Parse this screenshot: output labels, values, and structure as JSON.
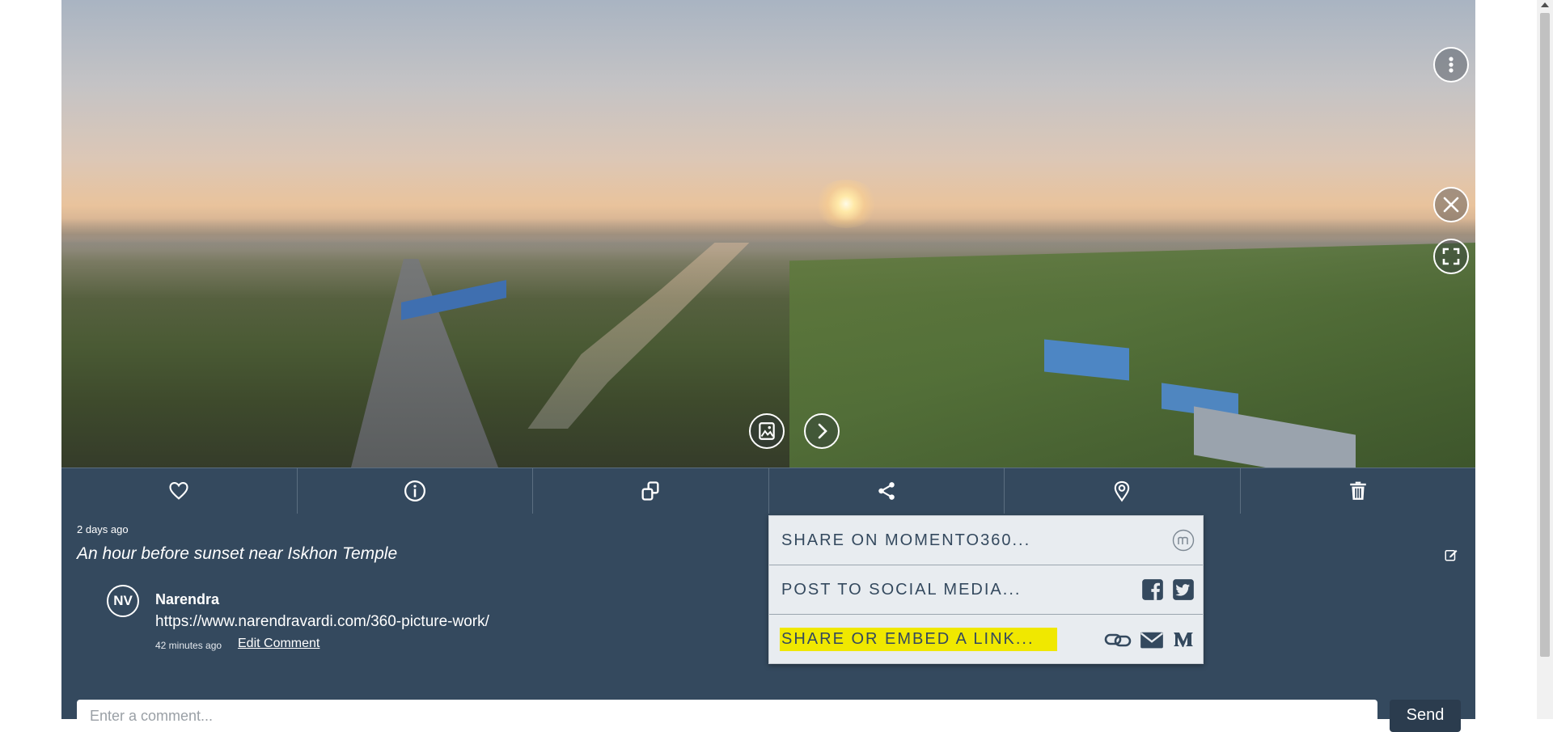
{
  "viewer": {
    "icons": {
      "menu": "more-vertical-icon",
      "close": "close-icon",
      "fullscreen": "fullscreen-icon",
      "image_info": "image-info-icon",
      "next": "chevron-right-icon"
    }
  },
  "toolbar": {
    "items": [
      {
        "name": "like",
        "icon": "heart-icon"
      },
      {
        "name": "info",
        "icon": "info-icon"
      },
      {
        "name": "copy",
        "icon": "copy-icon"
      },
      {
        "name": "share",
        "icon": "share-icon"
      },
      {
        "name": "location",
        "icon": "map-pin-icon"
      },
      {
        "name": "delete",
        "icon": "trash-icon"
      }
    ]
  },
  "post": {
    "timestamp": "2 days ago",
    "caption": "An hour before sunset near Iskhon Temple"
  },
  "comment": {
    "avatar_initials": "NV",
    "author": "Narendra",
    "text": "https://www.narendravardi.com/360-picture-work/",
    "time": "42 minutes ago",
    "edit_label": "Edit Comment"
  },
  "comment_box": {
    "placeholder": "Enter a comment...",
    "send_label": "Send"
  },
  "share_menu": {
    "items": [
      {
        "label": "SHARE ON MOMENTO360...",
        "icons": [
          "momento360-icon"
        ]
      },
      {
        "label": "POST TO SOCIAL MEDIA...",
        "icons": [
          "facebook-icon",
          "twitter-icon"
        ]
      },
      {
        "label": "SHARE OR EMBED A LINK...",
        "icons": [
          "link-icon",
          "email-icon",
          "medium-icon"
        ],
        "highlighted": true
      }
    ]
  },
  "colors": {
    "panel": "#34495e",
    "menu_bg": "#e8ecf0",
    "highlight": "#f0e800"
  }
}
